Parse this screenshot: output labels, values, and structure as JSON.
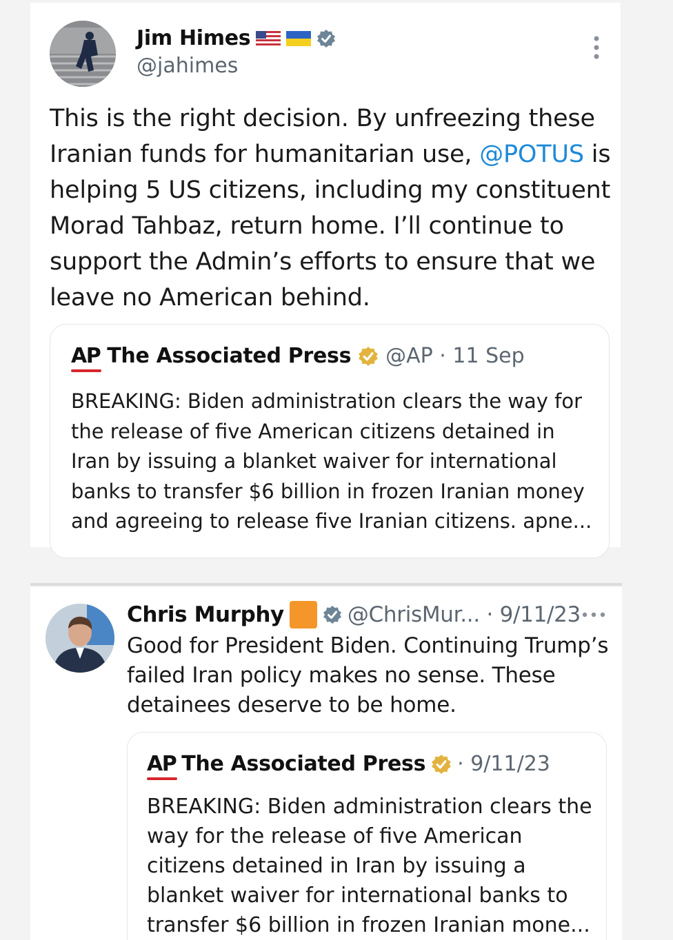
{
  "tweet1": {
    "author_name": "Jim Himes",
    "handle": "@jahimes",
    "text_before_mention": "This is the right decision. By unfreezing these Iranian funds for humanitarian use, ",
    "mention": "@POTUS",
    "text_after_mention": " is helping 5 US citizens, including my constituent Morad Tahbaz, return home. I’ll continue to support the Admin’s efforts to ensure that we leave no American behind.",
    "quote": {
      "logo": "AP",
      "name": "The Associated Press",
      "meta": "@AP · 11 Sep",
      "text": "BREAKING: Biden administration clears the way for the release of five American citizens detained in Iran by issuing a blanket waiver for international banks to transfer $6 billion in frozen Iranian money and agreeing to release five Iranian citizens. apne..."
    }
  },
  "tweet2": {
    "author_name": "Chris Murphy",
    "meta": "@ChrisMur... · 9/11/23",
    "text": "Good for President Biden. Continuing Trump’s failed Iran policy makes no sense. These detainees deserve to be home.",
    "quote": {
      "logo": "AP",
      "name": "The Associated Press",
      "meta": "· 9/11/23",
      "text": "BREAKING: Biden administration clears the way for the release of five American citizens detained in Iran by issuing a blanket waiver for international banks to transfer $6 billion in frozen Iranian mone..."
    }
  },
  "colors": {
    "link": "#1d8ad8",
    "verified_blue": "#6d8597",
    "verified_gold": "#e2b33e",
    "ap_red": "#d7262d",
    "orange_square": "#f5962a"
  },
  "icons": [
    "flag-us-icon",
    "flag-ukraine-icon",
    "verified-badge-icon",
    "more-vertical-icon",
    "gold-verified-badge-icon",
    "more-horizontal-icon"
  ]
}
